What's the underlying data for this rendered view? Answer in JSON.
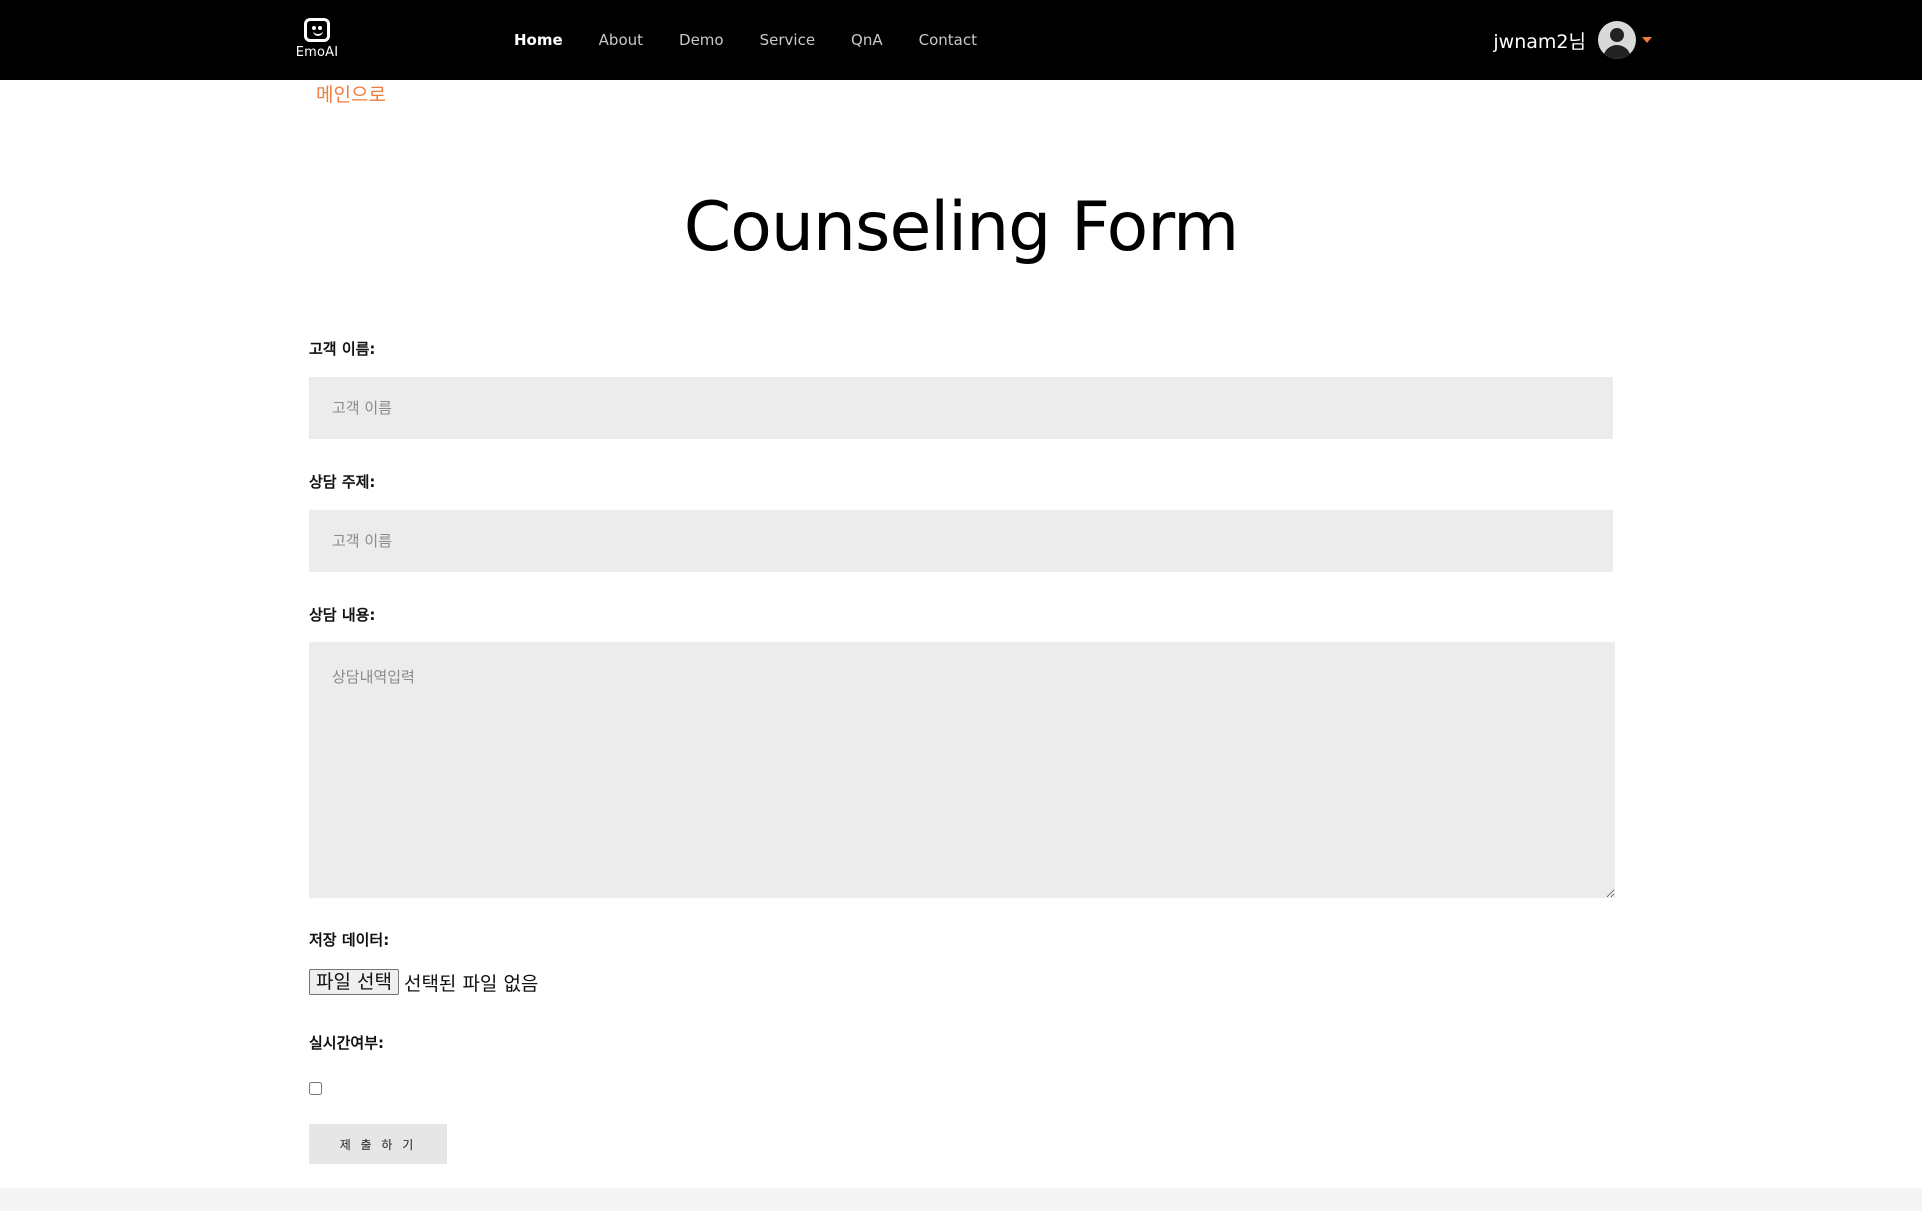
{
  "header": {
    "logo_text": "EmoAI",
    "nav": [
      {
        "label": "Home",
        "active": true
      },
      {
        "label": "About",
        "active": false
      },
      {
        "label": "Demo",
        "active": false
      },
      {
        "label": "Service",
        "active": false
      },
      {
        "label": "QnA",
        "active": false
      },
      {
        "label": "Contact",
        "active": false
      }
    ],
    "user_name": "jwnam2님"
  },
  "back_link": "메인으로",
  "page_title": "Counseling Form",
  "form": {
    "customer_name": {
      "label": "고객 이름:",
      "placeholder": "고객 이름",
      "value": ""
    },
    "subject": {
      "label": "상담 주제:",
      "placeholder": "고객 이름",
      "value": ""
    },
    "content": {
      "label": "상담 내용:",
      "placeholder": "상담내역입력",
      "value": ""
    },
    "file": {
      "label": "저장 데이터:",
      "button_label": "파일 선택",
      "status": "선택된 파일 없음"
    },
    "realtime": {
      "label": "실시간여부:",
      "checked": false
    },
    "submit_label": "제 출 하 기"
  },
  "colors": {
    "header_bg": "#000000",
    "accent": "#f07c3c",
    "field_bg": "#ececec"
  }
}
